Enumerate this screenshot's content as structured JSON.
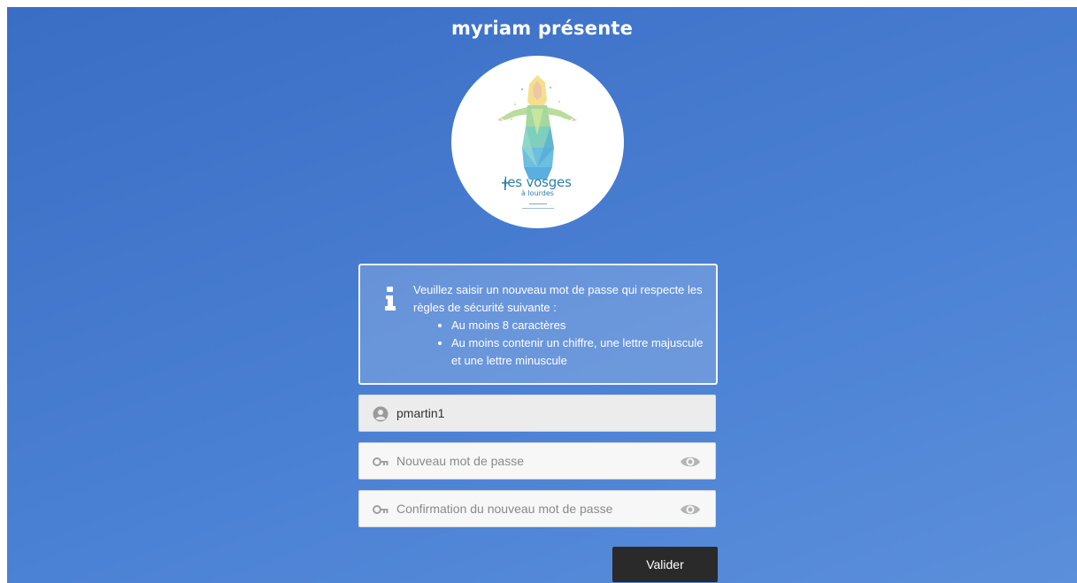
{
  "header": {
    "title": "myriam présente"
  },
  "logo": {
    "main_text": "les vosges",
    "sub_text": "à lourdes"
  },
  "info": {
    "intro": "Veuillez saisir un nouveau mot de passe qui respecte les règles de sécurité suivante :",
    "rules": [
      "Au moins 8 caractères",
      "Au moins contenir un chiffre, une lettre majuscule et une lettre minuscule"
    ]
  },
  "form": {
    "username": "pmartin1",
    "new_password_placeholder": "Nouveau mot de passe",
    "confirm_password_placeholder": "Confirmation du nouveau mot de passe",
    "submit_label": "Valider"
  },
  "icons": {
    "info": "info-icon",
    "user": "user-circle-icon",
    "key": "key-icon",
    "eye": "eye-icon"
  },
  "colors": {
    "background_top": "#3a6dc4",
    "background_bottom": "#5b8fdb",
    "button": "#2a2a2a"
  }
}
